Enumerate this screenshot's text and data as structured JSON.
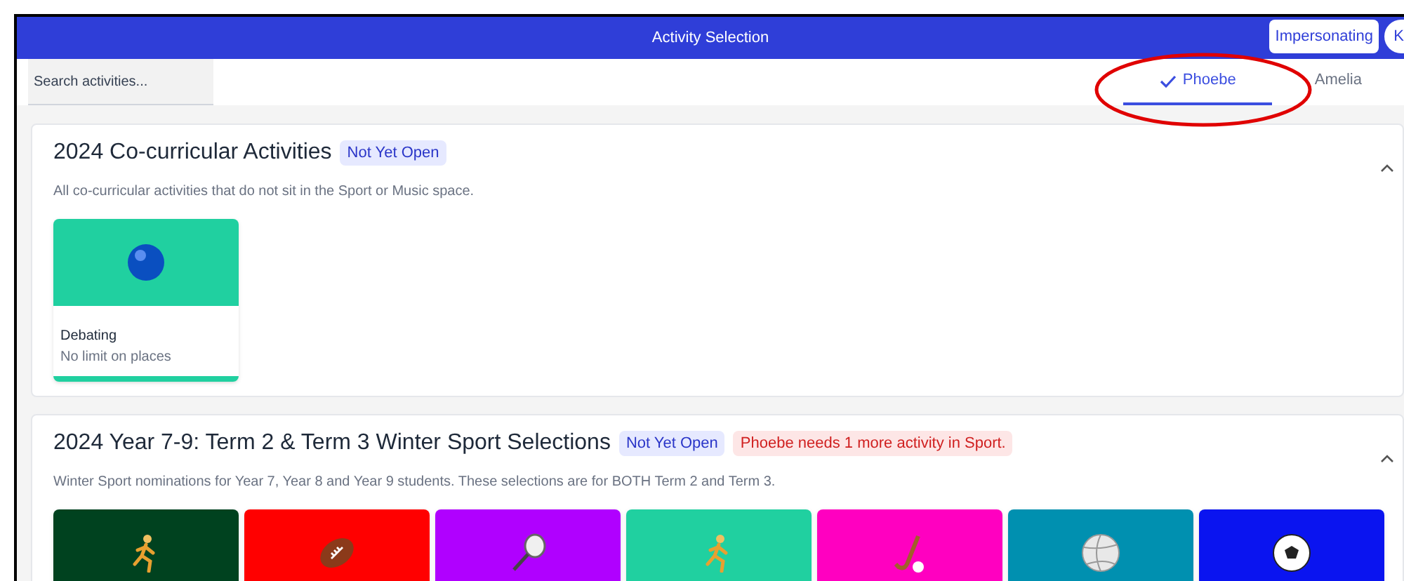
{
  "header": {
    "title": "Activity Selection",
    "impersonating_button": "Impersonating",
    "avatar_initial": "K"
  },
  "search": {
    "placeholder": "Search activities..."
  },
  "tabs": [
    {
      "label": "Phoebe",
      "selected": true
    },
    {
      "label": "Amelia",
      "selected": false
    }
  ],
  "sections": [
    {
      "title": "2024 Co-curricular Activities",
      "badges": [
        {
          "kind": "info",
          "text": "Not Yet Open"
        }
      ],
      "description": "All co-curricular activities that do not sit in the Sport or Music space.",
      "expanded": true,
      "activities": [
        {
          "kind": "ball",
          "color": "#20d0a0",
          "name": "Debating",
          "places": "No limit on places"
        }
      ]
    },
    {
      "title": "2024 Year 7-9: Term 2 & Term 3 Winter Sport Selections",
      "badges": [
        {
          "kind": "info",
          "text": "Not Yet Open"
        },
        {
          "kind": "warning",
          "text": "Phoebe needs 1 more activity in Sport."
        }
      ],
      "description": "Winter Sport nominations for Year 7, Year 8 and Year 9 students. These selections are for BOTH Term 2 and Term 3.",
      "expanded": true,
      "activities": [
        {
          "kind": "runner",
          "color": "#00421f"
        },
        {
          "kind": "football",
          "color": "#ff0000"
        },
        {
          "kind": "racket",
          "color": "#b000ff"
        },
        {
          "kind": "runner",
          "color": "#20d0a0"
        },
        {
          "kind": "hockey",
          "color": "#ff00c0"
        },
        {
          "kind": "volleyball",
          "color": "#0090b0"
        },
        {
          "kind": "soccer",
          "color": "#0a14f0"
        }
      ]
    }
  ]
}
